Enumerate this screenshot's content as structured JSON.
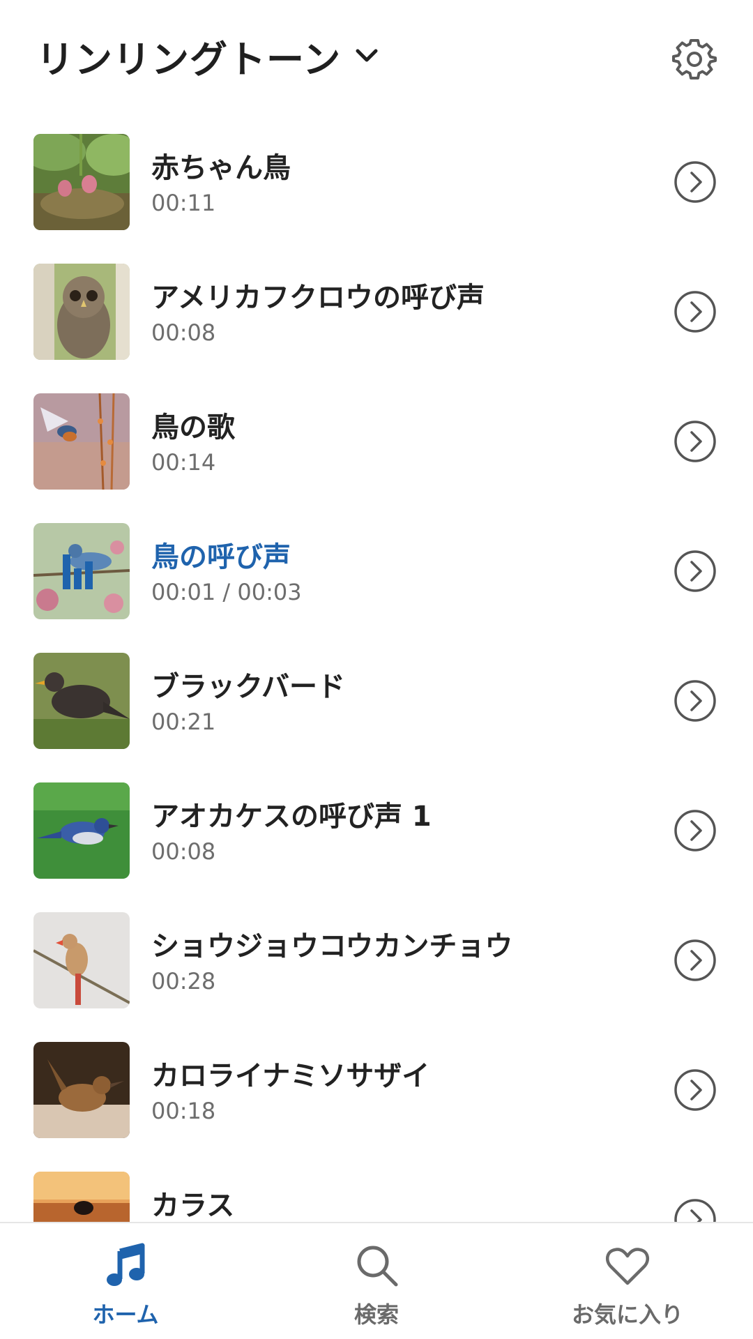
{
  "header": {
    "title": "リンリングトーン",
    "chevron_icon": "chevron-down-icon",
    "settings_icon": "gear-icon"
  },
  "colors": {
    "accent": "#1f63ad",
    "text_primary": "#222222",
    "text_secondary": "#6d6d6d",
    "icon_gray": "#5a5a5a"
  },
  "ringtones": [
    {
      "title": "赤ちゃん鳥",
      "time": "00:11",
      "thumbnail": "baby-birds-nest",
      "active": false
    },
    {
      "title": "アメリカフクロウの呼び声",
      "time": "00:08",
      "thumbnail": "barred-owl",
      "active": false
    },
    {
      "title": "鳥の歌",
      "time": "00:14",
      "thumbnail": "hummingbird-flowers",
      "active": false
    },
    {
      "title": "鳥の呼び声",
      "time": "00:01 / 00:03",
      "thumbnail": "blue-bird-branch",
      "active": true,
      "playing_icon": "equalizer-icon"
    },
    {
      "title": "ブラックバード",
      "time": "00:21",
      "thumbnail": "blackbird-grass",
      "active": false
    },
    {
      "title": "アオカケスの呼び声 1",
      "time": "00:08",
      "thumbnail": "blue-jay-grass",
      "active": false
    },
    {
      "title": "ショウジョウコウカンチョウ",
      "time": "00:28",
      "thumbnail": "cardinal-branch",
      "active": false
    },
    {
      "title": "カロライナミソサザイ",
      "time": "00:18",
      "thumbnail": "carolina-wren",
      "active": false
    },
    {
      "title": "カラス",
      "time": "",
      "thumbnail": "crow-sunset",
      "active": false
    }
  ],
  "row_arrow_icon": "chevron-right-circle-icon",
  "bottom_nav": [
    {
      "label": "ホーム",
      "icon": "music-note-icon",
      "active": true
    },
    {
      "label": "検索",
      "icon": "search-icon",
      "active": false
    },
    {
      "label": "お気に入り",
      "icon": "heart-icon",
      "active": false
    }
  ]
}
